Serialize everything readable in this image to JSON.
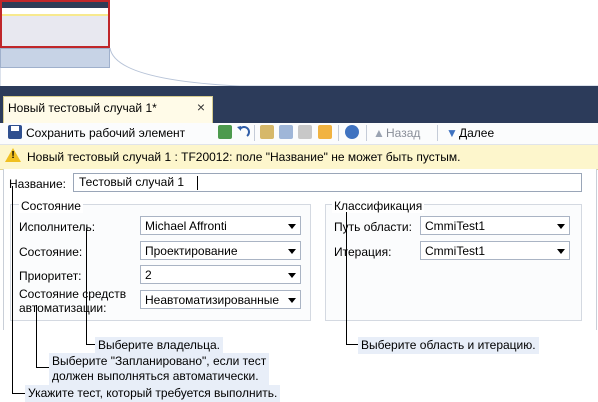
{
  "tab": {
    "title": "Новый тестовый случай 1*",
    "close": "×"
  },
  "toolbar": {
    "save_label": "Сохранить рабочий элемент",
    "back_label": "Назад",
    "forward_label": "Далее"
  },
  "infobar": {
    "message": "Новый тестовый случай 1 : TF20012: поле \"Название\" не может быть пустым."
  },
  "form": {
    "title_label": "Название:",
    "title_value": "Тестовый случай 1",
    "state_group": {
      "title": "Состояние",
      "fields": [
        {
          "label": "Исполнитель:",
          "value": "Michael Affronti"
        },
        {
          "label": "Состояние:",
          "value": "Проектирование"
        },
        {
          "label": "Приоритет:",
          "value": "2"
        },
        {
          "label": "Состояние средств автоматизации:",
          "value": "Неавтоматизированные"
        }
      ]
    },
    "class_group": {
      "title": "Классификация",
      "fields": [
        {
          "label": "Путь области:",
          "value": "CmmiTest1"
        },
        {
          "label": "Итерация:",
          "value": "CmmiTest1"
        }
      ]
    }
  },
  "callouts": {
    "owner": "Выберите владельца.",
    "area": "Выберите область и итерацию.",
    "automation_line1": "Выберите \"Запланировано\", если тест",
    "automation_line2": "должен выполняться автоматически.",
    "title": "Укажите тест, который требуется выполнить."
  },
  "colors": {
    "tabstrip": "#2c3b5a",
    "doc_tab": "#fffbe8",
    "infobar": "#fdf6cc",
    "callout_bg": "#e8eef8",
    "thumb_border": "#c0262a"
  }
}
